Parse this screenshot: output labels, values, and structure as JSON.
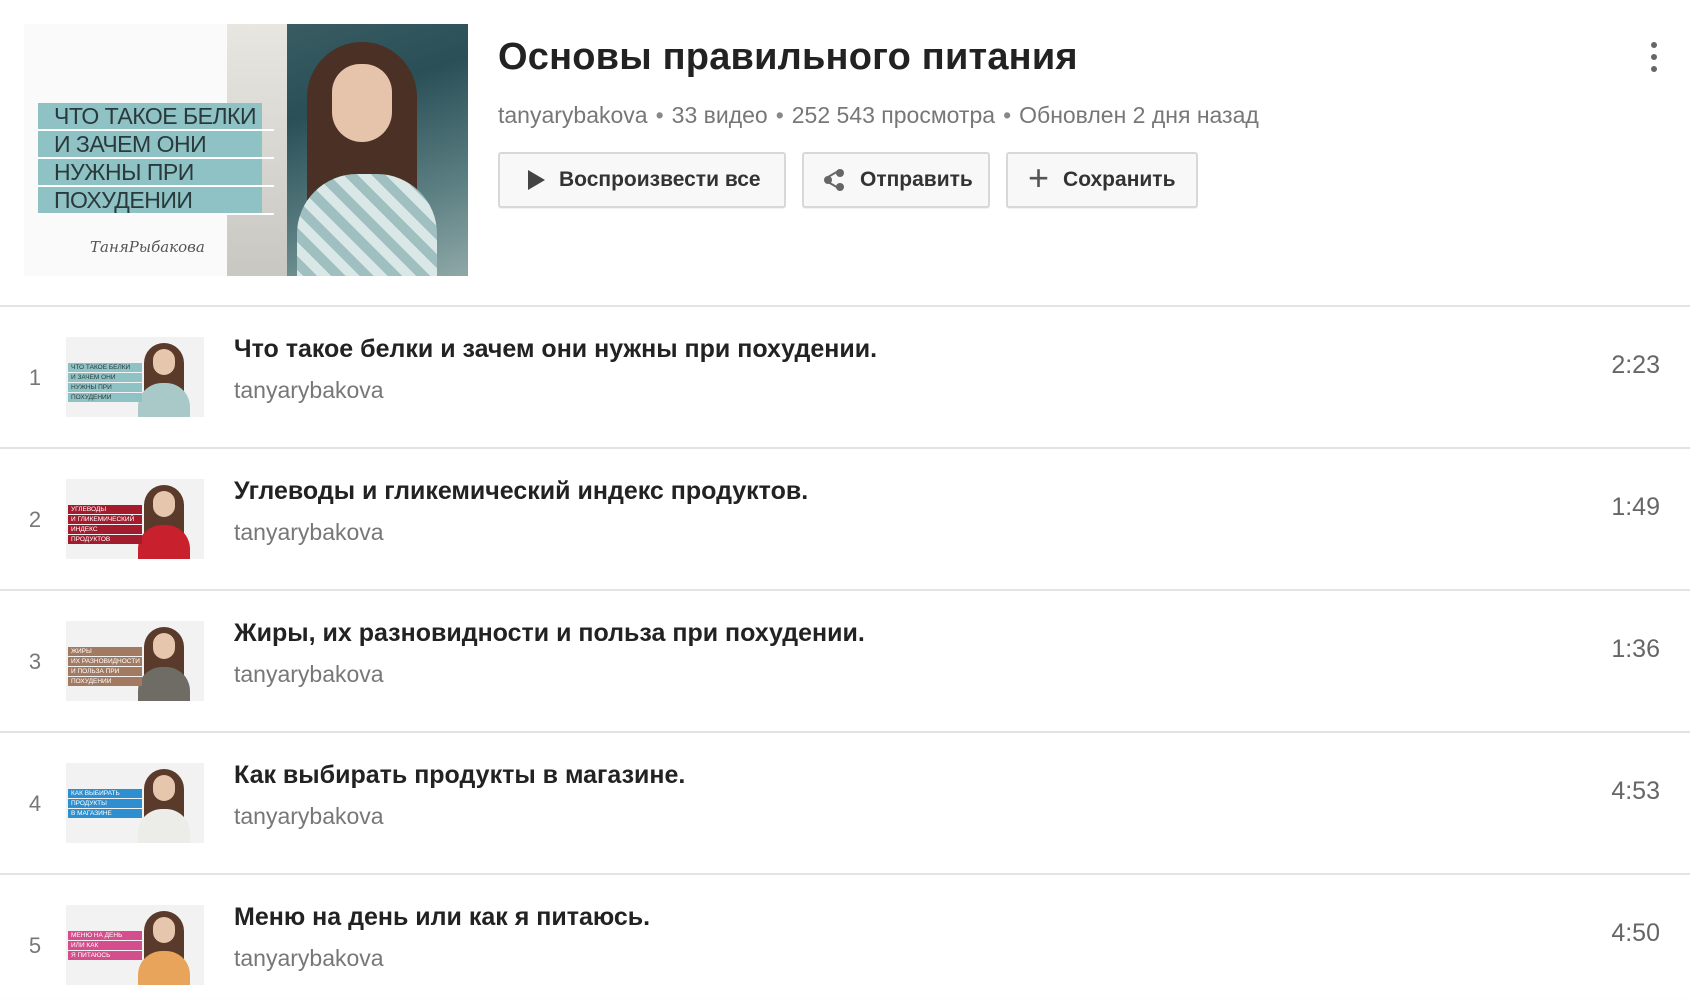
{
  "playlist": {
    "thumbnail_lines": [
      "ЧТО ТАКОЕ БЕЛКИ",
      "И ЗАЧЕМ ОНИ",
      "НУЖНЫ ПРИ",
      "ПОХУДЕНИИ"
    ],
    "thumbnail_signature": "ТаняРыбакова",
    "title": "Основы правильного питания",
    "meta": {
      "channel": "tanyarybakova",
      "video_count": "33 видео",
      "views": "252 543 просмотра",
      "updated": "Обновлен 2 дня назад",
      "separator": "•"
    },
    "buttons": {
      "play_all": "Воспроизвести все",
      "share": "Отправить",
      "save": "Сохранить"
    },
    "icons": {
      "play": "play-icon",
      "share": "share-icon",
      "save": "plus-icon",
      "more": "more-vertical-icon"
    }
  },
  "videos": [
    {
      "index": "1",
      "title": "Что такое белки и зачем они нужны при похудении.",
      "channel": "tanyarybakova",
      "duration": "2:23",
      "thumb_lines": [
        "ЧТО ТАКОЕ БЕЛКИ",
        "И ЗАЧЕМ ОНИ",
        "НУЖНЫ ПРИ",
        "ПОХУДЕНИИ"
      ],
      "thumb_color": "#8fc2c4",
      "thumb_text_color": "#2a3a3c",
      "thumb_body_color": "#a9c8c8"
    },
    {
      "index": "2",
      "title": "Углеводы и гликемический индекс продуктов.",
      "channel": "tanyarybakova",
      "duration": "1:49",
      "thumb_lines": [
        "УГЛЕВОДЫ",
        "И ГЛИКЕМИЧЕСКИЙ",
        "ИНДЕКС",
        "ПРОДУКТОВ"
      ],
      "thumb_color": "#a31c2e",
      "thumb_text_color": "#ffffff",
      "thumb_body_color": "#c8202c"
    },
    {
      "index": "3",
      "title": "Жиры, их разновидности и польза при похудении.",
      "channel": "tanyarybakova",
      "duration": "1:36",
      "thumb_lines": [
        "ЖИРЫ",
        "ИХ РАЗНОВИДНОСТИ",
        "И ПОЛЬЗА ПРИ",
        "ПОХУДЕНИИ"
      ],
      "thumb_color": "#a27a62",
      "thumb_text_color": "#ffffff",
      "thumb_body_color": "#6f6c66"
    },
    {
      "index": "4",
      "title": "Как выбирать продукты в магазине.",
      "channel": "tanyarybakova",
      "duration": "4:53",
      "thumb_lines": [
        "КАК ВЫБИРАТЬ",
        "ПРОДУКТЫ",
        "В МАГАЗИНЕ"
      ],
      "thumb_color": "#2d8fd0",
      "thumb_text_color": "#ffffff",
      "thumb_body_color": "#ecece8"
    },
    {
      "index": "5",
      "title": "Меню на день или как я питаюсь.",
      "channel": "tanyarybakova",
      "duration": "4:50",
      "thumb_lines": [
        "МЕНЮ НА ДЕНЬ",
        "ИЛИ КАК",
        "Я ПИТАЮСЬ"
      ],
      "thumb_color": "#d44d8c",
      "thumb_text_color": "#ffffff",
      "thumb_body_color": "#e7a45a"
    }
  ]
}
